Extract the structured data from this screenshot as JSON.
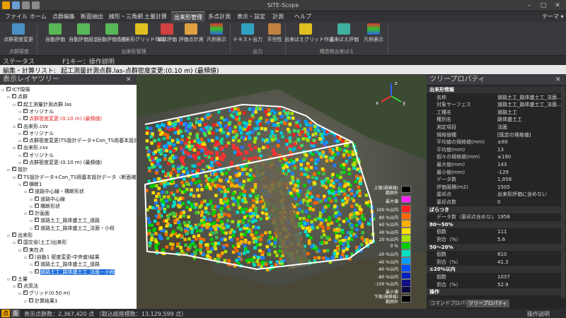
{
  "app": {
    "title": "SITE-Scope",
    "theme_label": "テーマ ▾"
  },
  "menu": [
    "ファイル",
    "ホーム",
    "点群編集",
    "断面抽出",
    "線形・三角網",
    "土量計算",
    "出来形管理",
    "多点計測",
    "表示・設定",
    "計測",
    "ヘルプ"
  ],
  "ribbon": {
    "buttons": [
      "点群密度変更",
      "自動評価",
      "自動評価設定",
      "自動評価条件",
      "出来形グリッド作成",
      "単体評価",
      "評価点計測",
      "凡例表示",
      "テキスト出力",
      "平坦性",
      "出来ばえグリッド作成",
      "出来ばえ評価",
      "凡例表示"
    ],
    "groups": [
      "点群密度",
      "出来形管理",
      "出力",
      "構造物出来ばえ"
    ]
  },
  "status": {
    "label": "ステータス",
    "text": "F1キー：操作説明"
  },
  "edit": {
    "label": "編集・計算リスト:",
    "value": "起工測量計測点群.las-点群密度変更:(0.10 m) (最頻値)"
  },
  "left_panel": {
    "title": "表示レイヤツリー",
    "tree": [
      {
        "label": "ICT現場",
        "indent": 0,
        "check": true
      },
      {
        "label": "点群",
        "indent": 1,
        "check": true
      },
      {
        "label": "起工測量計測点群.las",
        "indent": 2,
        "check": true
      },
      {
        "label": "オリジナル",
        "indent": 3,
        "check": true
      },
      {
        "label": "点群密度変更:(0.10 m) (最頻値)",
        "indent": 3,
        "check": true,
        "red": true
      },
      {
        "label": "出来形.csv",
        "indent": 2,
        "check": true
      },
      {
        "label": "オリジナル",
        "indent": 3,
        "check": true
      },
      {
        "label": "点群密度変更(TS設計データ+Con_TS用基本設計データ",
        "indent": 3,
        "check": true
      },
      {
        "label": "出来形.csv",
        "indent": 2,
        "check": true
      },
      {
        "label": "オリジナル",
        "indent": 3,
        "check": true
      },
      {
        "label": "点群密度変更:(0.10 m) (最頻値)",
        "indent": 3,
        "check": true
      },
      {
        "label": "設計",
        "indent": 1,
        "check": true
      },
      {
        "label": "TS設計データ+Con_TS用基本設計データ（断面補間済み）.x",
        "indent": 2,
        "check": true
      },
      {
        "label": "横断1",
        "indent": 3,
        "check": true
      },
      {
        "label": "道路中心線・構断形状",
        "indent": 4,
        "check": true
      },
      {
        "label": "道路中心線",
        "indent": 5,
        "check": true
      },
      {
        "label": "構断形状",
        "indent": 5,
        "check": true
      },
      {
        "label": "計画面",
        "indent": 4,
        "check": true
      },
      {
        "label": "道路土工_路体盛土工_道路",
        "indent": 5,
        "check": true
      },
      {
        "label": "道路土工_路体盛土工_法面・小段",
        "indent": 5,
        "check": true
      },
      {
        "label": "出来形",
        "indent": 1,
        "check": true
      },
      {
        "label": "国交省(土工)出来形",
        "indent": 2,
        "check": true
      },
      {
        "label": "実在点",
        "indent": 3,
        "check": true
      },
      {
        "label": "(自動1 密度変更-中央値)結果",
        "indent": 4,
        "check": true
      },
      {
        "label": "道路土工_路体盛土工_道路",
        "indent": 5,
        "check": true
      },
      {
        "label": "道路土工_路体盛土工_法面・小段",
        "indent": 5,
        "check": true,
        "selected": true
      },
      {
        "label": "土量",
        "indent": 1,
        "check": true
      },
      {
        "label": "点高法",
        "indent": 2,
        "check": true
      },
      {
        "label": "グリッド(0.50 m)",
        "indent": 3,
        "check": true
      },
      {
        "label": "計算結果1",
        "indent": 4,
        "check": true
      }
    ]
  },
  "legend": {
    "top_label": "上限(規格値)\n範囲外",
    "max_label": "最大値",
    "rows": [
      "100 %以内",
      "80 %以内",
      "60 %以内",
      "40 %以内",
      "20 %以内",
      "0 %",
      "-20 %以内",
      "-40 %以内",
      "-60 %以内",
      "-80 %以内",
      "-100 %以内"
    ],
    "min_label": "最小値",
    "bottom_label": "下限(規格値)\n範囲外",
    "colors": [
      "#ff2020",
      "#ff6a00",
      "#ffb000",
      "#ffe000",
      "#a8e000",
      "#00d000",
      "#00e0c0",
      "#00a0ff",
      "#0050ff",
      "#0020c0",
      "#101080"
    ]
  },
  "right_panel": {
    "title": "ツリープロパティ",
    "rows": [
      {
        "k": "出来形情報",
        "v": "",
        "sec": true
      },
      {
        "k": "名称",
        "v": "道路土工_路体盛土工_法面..."
      },
      {
        "k": "対象サーフェス",
        "v": "道路土工_路体盛土工_法面..."
      },
      {
        "k": "工種名",
        "v": "道路土工"
      },
      {
        "k": "種別名",
        "v": "路体盛土工"
      },
      {
        "k": "測定項目",
        "v": "法面"
      },
      {
        "k": "規格値種",
        "v": "[既定の規格値]"
      },
      {
        "k": "平均値の規格値(mm)",
        "v": "±80"
      },
      {
        "k": "平均値(mm)",
        "v": "13"
      },
      {
        "k": "個々の規格値(mm)",
        "v": "±190"
      },
      {
        "k": "最大値(mm)",
        "v": "143"
      },
      {
        "k": "最小値(mm)",
        "v": "-129"
      },
      {
        "k": "データ数",
        "v": "1,958"
      },
      {
        "k": "評価面積(m2)",
        "v": "1505"
      },
      {
        "k": "棄却点",
        "v": "出来形評価に含めない"
      },
      {
        "k": "棄却点数",
        "v": "0"
      },
      {
        "k": "ばらつき",
        "v": "",
        "sec": true
      },
      {
        "k": "データ数（棄却点含めない）",
        "v": "1958"
      },
      {
        "k": "80〜50%",
        "v": "",
        "sec": true
      },
      {
        "k": "個数",
        "v": "111"
      },
      {
        "k": "割合（%）",
        "v": "5.6"
      },
      {
        "k": "50〜20%",
        "v": "",
        "sec": true
      },
      {
        "k": "個数",
        "v": "810"
      },
      {
        "k": "割合（%）",
        "v": "41.3"
      },
      {
        "k": "±20%以内",
        "v": "",
        "sec": true
      },
      {
        "k": "個数",
        "v": "1037"
      },
      {
        "k": "割合（%）",
        "v": "52.9"
      },
      {
        "k": "操作",
        "v": "",
        "sec": true
      }
    ],
    "tabs": [
      "コマンドプロパティ",
      "ツリープロパティ"
    ]
  },
  "bottom": {
    "mode1": "点",
    "mode2": "面",
    "text": "表示点群数：2,367,420 点 （取込総座標数：13,129,599 点）",
    "help": "操作説明"
  }
}
